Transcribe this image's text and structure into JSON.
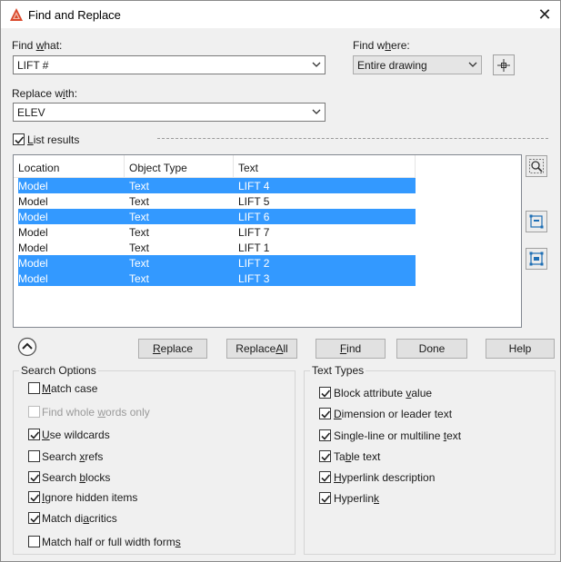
{
  "window": {
    "title": "Find and Replace",
    "close_glyph": "✕"
  },
  "find_what": {
    "label_prefix": "Find ",
    "label_accel": "w",
    "label_suffix": "hat:",
    "value": "LIFT #"
  },
  "find_where": {
    "label_prefix": "Find w",
    "label_accel": "h",
    "label_suffix": "ere:",
    "value": "Entire drawing"
  },
  "replace_with": {
    "label_prefix": "Replace w",
    "label_accel": "i",
    "label_suffix": "th:",
    "value": "ELEV"
  },
  "list_results": {
    "label_accel": "L",
    "label_rest": "ist results",
    "checked": true
  },
  "results_table": {
    "columns": [
      "Location",
      "Object Type",
      "Text"
    ],
    "rows": [
      {
        "location": "Model",
        "type": "Text",
        "text": "LIFT 4",
        "selected": true
      },
      {
        "location": "Model",
        "type": "Text",
        "text": "LIFT 5",
        "selected": false
      },
      {
        "location": "Model",
        "type": "Text",
        "text": "LIFT 6",
        "selected": true
      },
      {
        "location": "Model",
        "type": "Text",
        "text": "LIFT 7",
        "selected": false
      },
      {
        "location": "Model",
        "type": "Text",
        "text": "LIFT 1",
        "selected": false
      },
      {
        "location": "Model",
        "type": "Text",
        "text": "LIFT 2",
        "selected": true
      },
      {
        "location": "Model",
        "type": "Text",
        "text": "LIFT 3",
        "selected": true
      }
    ]
  },
  "buttons": {
    "replace": {
      "accel": "R",
      "rest": "eplace"
    },
    "replace_all": {
      "pre": "Replace ",
      "accel": "A",
      "rest": "ll"
    },
    "find": {
      "accel": "F",
      "rest": "ind"
    },
    "done": "Done",
    "help": "Help"
  },
  "search_options": {
    "title": "Search Options",
    "items": [
      {
        "pre": "",
        "accel": "M",
        "rest": "atch case",
        "checked": false,
        "disabled": false
      },
      {
        "pre": "Find whole ",
        "accel": "w",
        "rest": "ords only",
        "checked": false,
        "disabled": true
      },
      {
        "pre": "",
        "accel": "U",
        "rest": "se wildcards",
        "checked": true,
        "disabled": false
      },
      {
        "pre": "Search ",
        "accel": "x",
        "rest": "refs",
        "checked": false,
        "disabled": false
      },
      {
        "pre": "Search ",
        "accel": "b",
        "rest": "locks",
        "checked": true,
        "disabled": false
      },
      {
        "pre": "",
        "accel": "I",
        "rest": "gnore hidden items",
        "checked": true,
        "disabled": false
      },
      {
        "pre": "Match di",
        "accel": "a",
        "rest": "critics",
        "checked": true,
        "disabled": false
      },
      {
        "pre": "Match half or full width form",
        "accel": "s",
        "rest": "",
        "checked": false,
        "disabled": false
      }
    ]
  },
  "text_types": {
    "title": "Text Types",
    "items": [
      {
        "pre": "Block attribute ",
        "accel": "v",
        "rest": "alue",
        "checked": true
      },
      {
        "pre": "",
        "accel": "D",
        "rest": "imension or leader text",
        "checked": true
      },
      {
        "pre": "Single-line or multiline ",
        "accel": "t",
        "rest": "ext",
        "checked": true
      },
      {
        "pre": "Ta",
        "accel": "b",
        "rest": "le text",
        "checked": true
      },
      {
        "pre": "",
        "accel": "H",
        "rest": "yperlink description",
        "checked": true
      },
      {
        "pre": "Hyperlin",
        "accel": "k",
        "rest": "",
        "checked": true
      }
    ]
  },
  "icons": {
    "app": "autocad-icon",
    "pick": "crosshair-icon",
    "zoom": "zoom-to-icon",
    "selection": "create-selection-set-icon",
    "selection_all": "create-selection-set-all-icon",
    "collapse": "collapse-up-icon"
  },
  "colors": {
    "selection": "#3399ff",
    "dialog_bg": "#f0f0f0"
  }
}
